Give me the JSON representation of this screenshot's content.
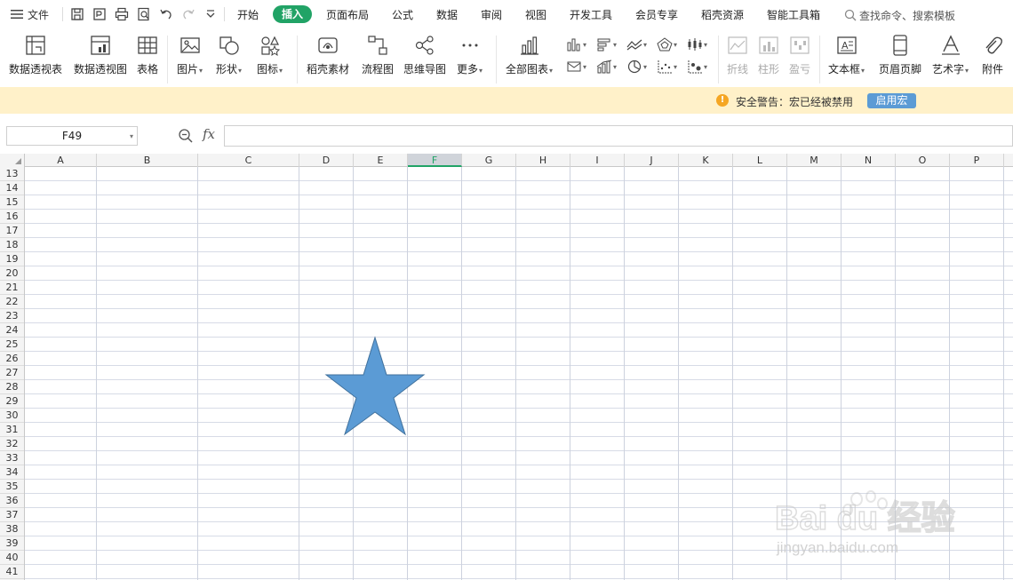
{
  "menu": {
    "file": "文件",
    "tabs": [
      "开始",
      "插入",
      "页面布局",
      "公式",
      "数据",
      "审阅",
      "视图",
      "开发工具",
      "会员专享",
      "稻壳资源",
      "智能工具箱"
    ],
    "active_tab": "插入",
    "search": "查找命令、搜索模板"
  },
  "ribbon": {
    "pivot_table": "数据透视表",
    "pivot_chart": "数据透视图",
    "table": "表格",
    "picture": "图片",
    "shape": "形状",
    "icon": "图标",
    "docer_material": "稻壳素材",
    "flowchart": "流程图",
    "mindmap": "思维导图",
    "more": "更多",
    "all_charts": "全部图表",
    "spark_line": "折线",
    "spark_column": "柱形",
    "spark_winloss": "盈亏",
    "textbox": "文本框",
    "header_footer": "页眉页脚",
    "wordart": "艺术字",
    "attachment": "附件"
  },
  "security": {
    "warning": "安全警告：宏已经被禁用",
    "enable_macro": "启用宏"
  },
  "formula_bar": {
    "name_box": "F49",
    "fx": "fx",
    "value": ""
  },
  "sheet": {
    "columns": [
      "A",
      "B",
      "C",
      "D",
      "E",
      "F",
      "G",
      "H",
      "I",
      "J",
      "K",
      "L",
      "M",
      "N",
      "O",
      "P"
    ],
    "selected_column": "F",
    "rows": [
      "13",
      "14",
      "15",
      "16",
      "17",
      "18",
      "19",
      "20",
      "21",
      "22",
      "23",
      "24",
      "25",
      "26",
      "27",
      "28",
      "29",
      "30",
      "31",
      "32",
      "33",
      "34",
      "35",
      "36",
      "37",
      "38",
      "39",
      "40",
      "41"
    ]
  },
  "shape": {
    "type": "five-point-star",
    "fill": "#5b9bd5",
    "stroke": "#41719c"
  },
  "colors": {
    "accent": "#21a366",
    "security_bg": "#fff1c9",
    "macro_button": "#5b9bd5"
  },
  "watermark": {
    "brand": "Bai du 经验",
    "url": "jingyan.baidu.com"
  }
}
